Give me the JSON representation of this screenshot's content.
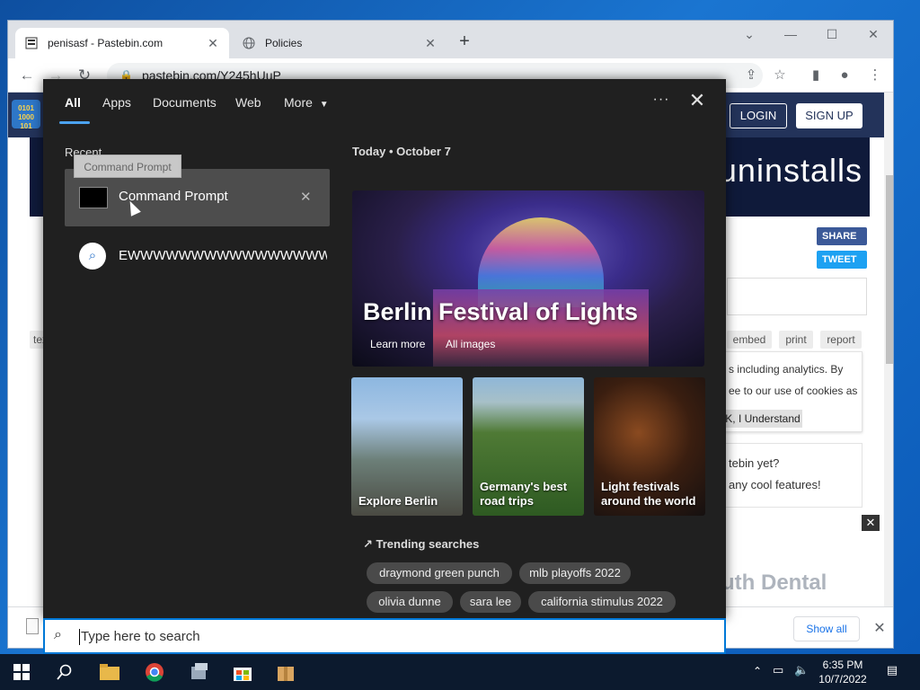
{
  "browser": {
    "tabs": [
      {
        "title": "penisasf - Pastebin.com",
        "icon": "pastebin-icon"
      },
      {
        "title": "Policies",
        "icon": "globe-icon"
      }
    ],
    "url": "pastebin.com/Y245hUuP"
  },
  "pastebin": {
    "login": "LOGIN",
    "signup": "SIGN UP",
    "banner_text": "uninstalls",
    "share": "SHARE",
    "tweet": "TWEET",
    "tools": [
      "tex",
      "embed",
      "print",
      "report"
    ],
    "cookie_line1": "s including analytics. By",
    "cookie_line2": "ee to our use of cookies as",
    "cookie_ok": "K, I Understand",
    "promo_line1": "tebin yet?",
    "promo_line2": "any cool features!",
    "ad_text": "uth Dental"
  },
  "downloads": {
    "show_all": "Show all"
  },
  "search_panel": {
    "tabs": [
      "All",
      "Apps",
      "Documents",
      "Web",
      "More"
    ],
    "recent_label": "Recent",
    "recent_items": [
      {
        "label": "Command Prompt",
        "icon": "cmd-icon",
        "tooltip": "Command Prompt"
      },
      {
        "label": "EWWWWWWWWWWWWWWWWW...",
        "icon": "search-icon"
      }
    ],
    "today": "Today",
    "date": "October 7",
    "hero": {
      "title": "Berlin Festival of Lights",
      "learn_more": "Learn more",
      "all_images": "All images"
    },
    "cards": [
      {
        "label": "Explore Berlin"
      },
      {
        "label": "Germany's best road trips"
      },
      {
        "label": "Light festivals around the world"
      }
    ],
    "trending_label": "Trending searches",
    "trending": [
      "draymond green punch",
      "mlb playoffs 2022",
      "olivia dunne",
      "sara lee",
      "california stimulus 2022"
    ],
    "placeholder": "Type here to search"
  },
  "taskbar": {
    "time": "6:35 PM",
    "date": "10/7/2022",
    "apps": [
      "start-icon",
      "search-icon",
      "file-explorer-icon",
      "chrome-icon",
      "server-manager-icon",
      "store-icon",
      "package-icon"
    ]
  }
}
